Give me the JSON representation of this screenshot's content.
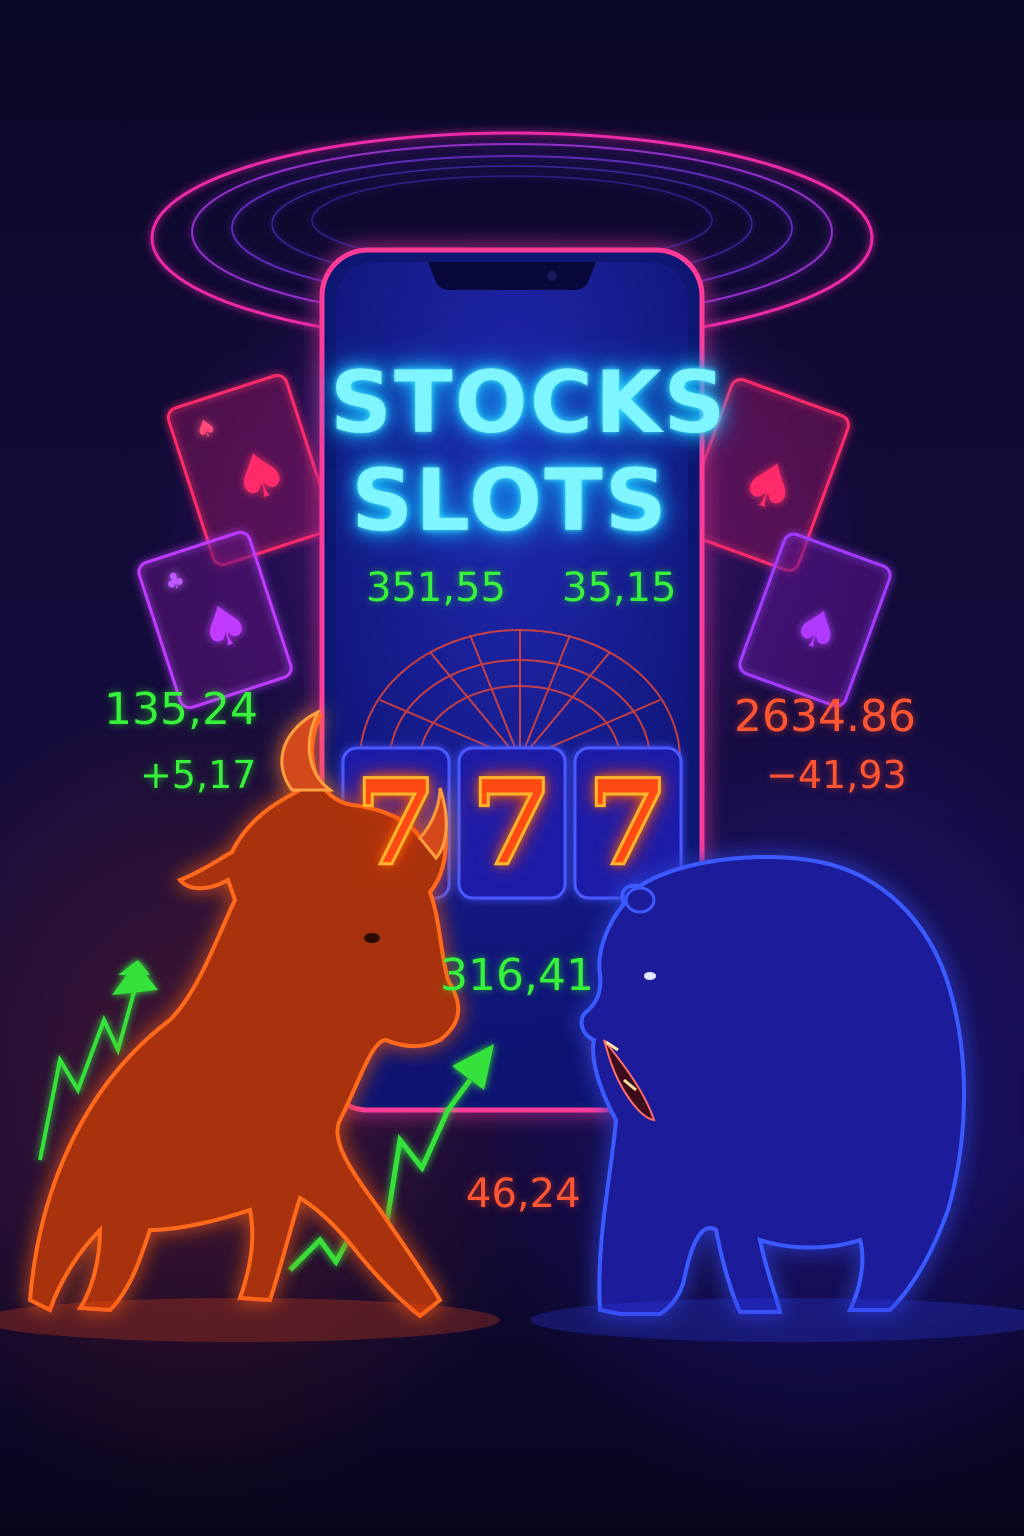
{
  "title": {
    "line1": "STOCKS",
    "line2": "SLOTS"
  },
  "phone_prices": {
    "left": "351,55",
    "right": "35,15"
  },
  "slot_reels": [
    "7",
    "7",
    "7"
  ],
  "left_ticker": {
    "price": "135,24",
    "change": "+5,17"
  },
  "right_ticker": {
    "price": "2634.86",
    "change": "−41,93"
  },
  "center_values": {
    "upper": "316,41",
    "lower": "46,24"
  },
  "colors": {
    "title_neon": "#7ff6ff",
    "gain_green": "#36f23a",
    "loss_red": "#ff5533",
    "bull_orange": "#ff5a14",
    "bear_blue": "#2a38e0",
    "background": "#0d0a2e"
  }
}
